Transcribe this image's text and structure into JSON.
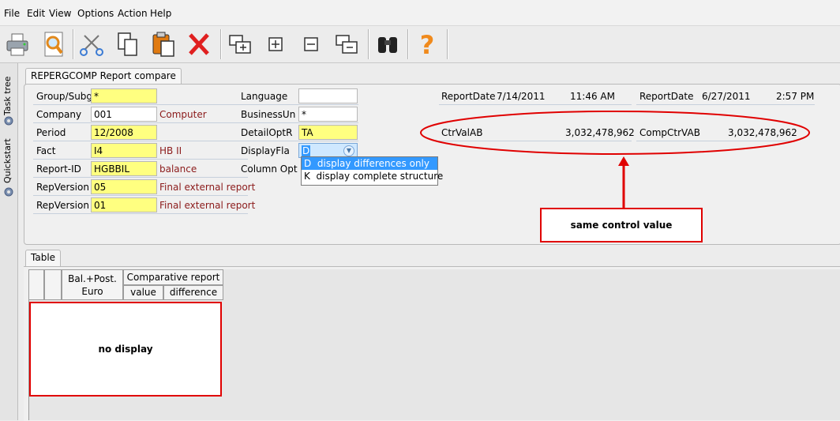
{
  "menu": {
    "file": "File",
    "edit": "Edit",
    "view": "View",
    "options": "Options",
    "action": "Action",
    "help": "Help"
  },
  "sidebar": {
    "task_tree": "Task tree",
    "quickstart": "Quickstart"
  },
  "form": {
    "tab_title": "REPERGCOMP Report compare",
    "group_subg": {
      "label": "Group/Subg",
      "value": "*"
    },
    "company": {
      "label": "Company",
      "value": "001",
      "desc": "Computer"
    },
    "period": {
      "label": "Period",
      "value": "12/2008"
    },
    "fact": {
      "label": "Fact",
      "value": "I4",
      "desc": "HB II"
    },
    "report_id": {
      "label": "Report-ID",
      "value": "HGBBIL",
      "desc": "balance"
    },
    "repversion1": {
      "label": "RepVersion",
      "value": "05",
      "desc": "Final external report"
    },
    "repversion2": {
      "label": "RepVersion",
      "value": "01",
      "desc": "Final external report"
    },
    "language": {
      "label": "Language",
      "value": ""
    },
    "business_un": {
      "label": "BusinessUn",
      "value": "*"
    },
    "detail_optr": {
      "label": "DetailOptR",
      "value": "TA"
    },
    "display_fla": {
      "label": "DisplayFla",
      "value": "D",
      "options": [
        "D  display differences only",
        "K  display complete structure"
      ]
    },
    "column_opt": {
      "label": "Column Opt"
    },
    "report_date1": {
      "label": "ReportDate",
      "date": "7/14/2011",
      "time": "11:46 AM"
    },
    "report_date2": {
      "label": "ReportDate",
      "date": "6/27/2011",
      "time": "2:57 PM"
    },
    "ctrvalab": {
      "label": "CtrValAB",
      "value": "3,032,478,962"
    },
    "compctrvab": {
      "label": "CompCtrVAB",
      "value": "3,032,478,962"
    },
    "annotation": "same control value"
  },
  "table": {
    "tab_title": "Table",
    "col_balpost": "Bal.+Post.",
    "col_euro": "Euro",
    "col_comparative": "Comparative report",
    "col_value": "value",
    "col_difference": "difference",
    "annotation": "no display"
  },
  "colors": {
    "field_yellow": "#ffff80",
    "annotation_red": "#e00000",
    "desc_text": "#8b1a1a"
  }
}
